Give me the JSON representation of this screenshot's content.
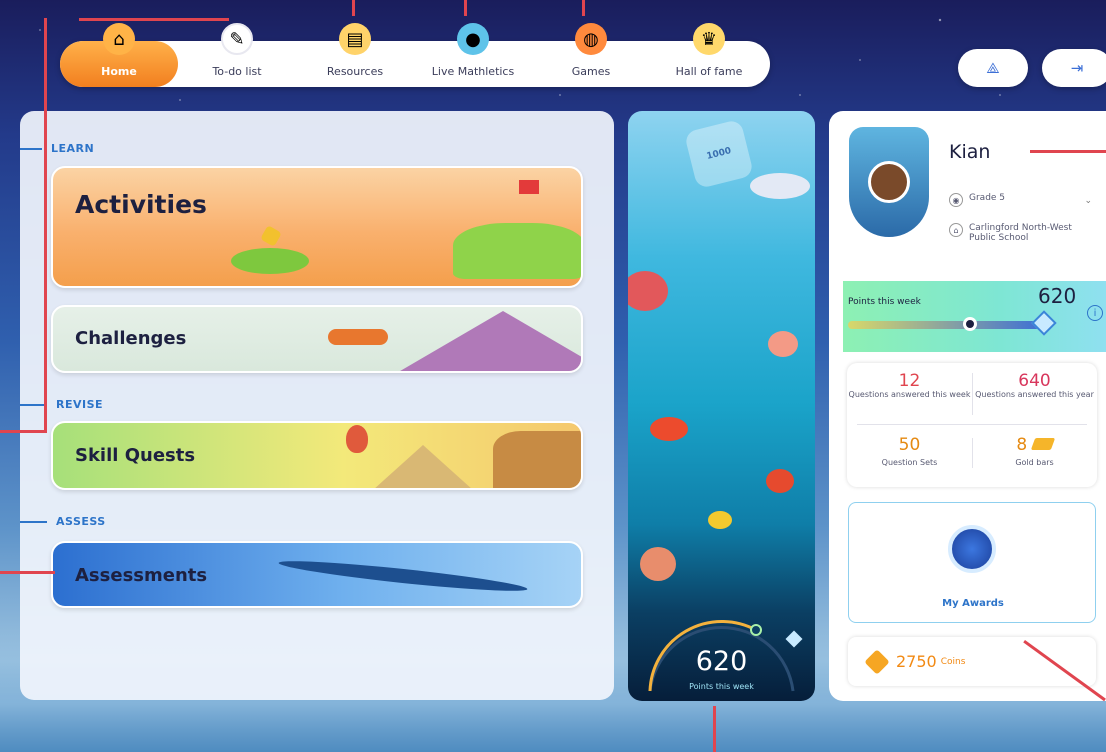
{
  "nav": {
    "items": [
      {
        "label": "Home",
        "icon": "house-icon",
        "active": true
      },
      {
        "label": "To-do list",
        "icon": "pencil-icon",
        "active": false
      },
      {
        "label": "Resources",
        "icon": "book-icon",
        "active": false
      },
      {
        "label": "Live Mathletics",
        "icon": "globe-icon",
        "active": false
      },
      {
        "label": "Games",
        "icon": "basketball-icon",
        "active": false
      },
      {
        "label": "Hall of fame",
        "icon": "trophy-icon",
        "active": false
      }
    ],
    "right_buttons": [
      {
        "icon": "avatar-builder-icon"
      },
      {
        "icon": "logout-icon"
      }
    ]
  },
  "sections": {
    "learn": "LEARN",
    "revise": "REVISE",
    "assess": "ASSESS"
  },
  "cards": {
    "activities": "Activities",
    "challenges": "Challenges",
    "skill_quests": "Skill Quests",
    "assessments": "Assessments"
  },
  "ocean": {
    "milestone": "1000",
    "points": "620",
    "points_label": "Points this week"
  },
  "profile": {
    "name": "Kian",
    "grade": "Grade 5",
    "school": "Carlingford North-West Public School"
  },
  "week": {
    "label": "Points this week",
    "value": "620",
    "progress": 0.62
  },
  "stats": {
    "q_week_num": "12",
    "q_week_label": "Questions answered this week",
    "q_year_num": "640",
    "q_year_label": "Questions answered this year",
    "sets_num": "50",
    "sets_label": "Question Sets",
    "gold_num": "8",
    "gold_label": "Gold bars"
  },
  "awards": {
    "label": "My Awards"
  },
  "coins": {
    "value": "2750",
    "label": "Coins"
  },
  "colors": {
    "accent": "#f27f1f",
    "primary": "#2d74c9",
    "annotation": "#e0454f"
  }
}
